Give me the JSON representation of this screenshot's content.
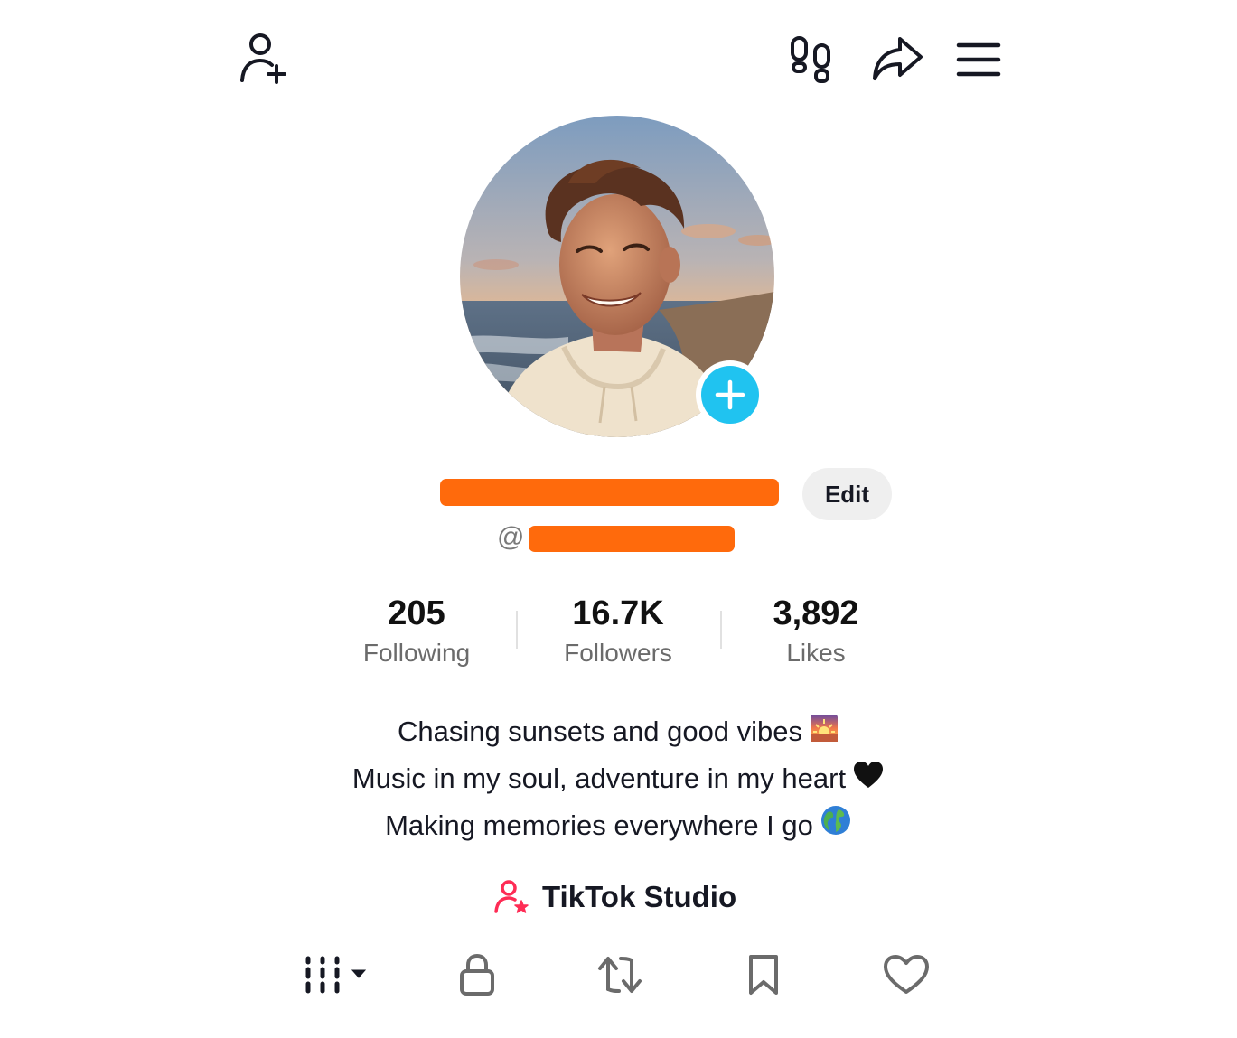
{
  "header": {
    "add_friend_icon": "person-plus-icon",
    "footprints_icon": "footprints-icon",
    "share_icon": "share-arrow-icon",
    "menu_icon": "hamburger-menu-icon"
  },
  "profile": {
    "display_name": "",
    "handle_prefix": "@",
    "handle": "",
    "edit_label": "Edit",
    "accent_color": "#20c3f0",
    "redaction_color": "#ff6a0c"
  },
  "stats": [
    {
      "value": "205",
      "label": "Following"
    },
    {
      "value": "16.7K",
      "label": "Followers"
    },
    {
      "value": "3,892",
      "label": "Likes"
    }
  ],
  "bio": {
    "lines": [
      "Chasing sunsets and good vibes",
      "Music in my soul, adventure in my heart",
      "Making memories everywhere I go"
    ],
    "emojis": [
      "sunset-emoji",
      "black-heart-emoji",
      "globe-emoji"
    ]
  },
  "studio": {
    "label": "TikTok Studio",
    "icon": "person-star-icon",
    "icon_color": "#fe2c55"
  },
  "tabs": [
    {
      "icon": "grid-videos-icon",
      "selected": true
    },
    {
      "icon": "lock-icon",
      "selected": false
    },
    {
      "icon": "repost-icon",
      "selected": false
    },
    {
      "icon": "bookmark-icon",
      "selected": false
    },
    {
      "icon": "heart-icon",
      "selected": false
    }
  ]
}
